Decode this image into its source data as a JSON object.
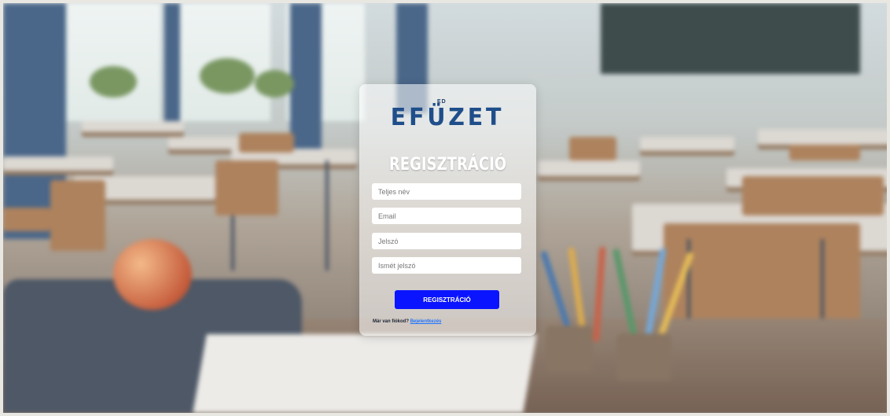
{
  "logo": {
    "small": "ED",
    "text": "EFÜZET"
  },
  "form": {
    "title": "REGISZTRÁCIÓ",
    "fields": [
      {
        "placeholder": "Teljes név",
        "value": ""
      },
      {
        "placeholder": "Email",
        "value": ""
      },
      {
        "placeholder": "Jelszó",
        "value": ""
      },
      {
        "placeholder": "Ismét jelszó",
        "value": ""
      }
    ],
    "submit_label": "REGISZTRÁCIÓ",
    "login_prompt": "Már van fiókod?",
    "login_link": "Bejelentkezés"
  },
  "colors": {
    "brand": "#1f4e8a",
    "button": "#0a14ff",
    "link": "#1f74ff"
  }
}
